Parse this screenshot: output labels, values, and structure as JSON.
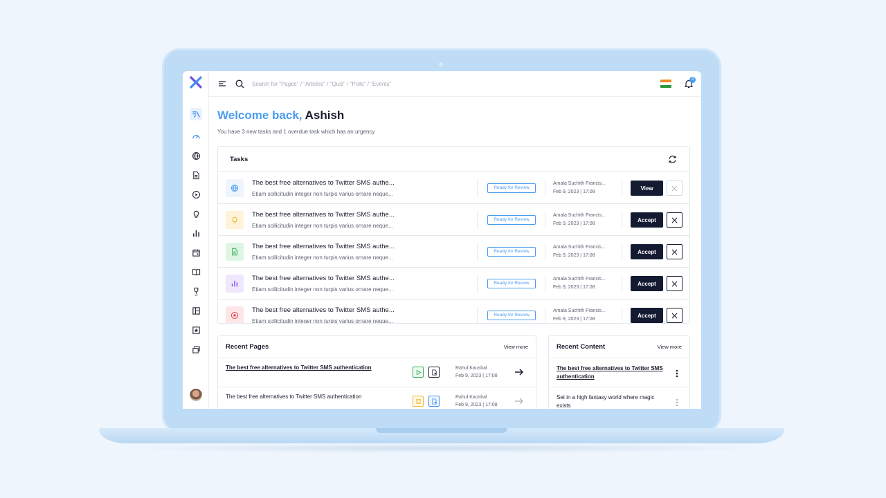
{
  "topbar": {
    "search_placeholder": "Search for \"Pages\" / \"Articles\" / \"Quiz\" / \"Polls\" / \"Events\"",
    "notification_count": "4"
  },
  "welcome": {
    "greeting": "Welcome back,",
    "name": "Ashish",
    "subtitle": "You have 3 new tasks and 1 overdue task which has an urgency"
  },
  "tasks": {
    "title": "Tasks",
    "rows": [
      {
        "icon": "globe-icon",
        "title": "The best free alternatives to Twitter SMS authe...",
        "desc": "Etiam sollicitudin integer non turpis varius ornare neque...",
        "status": "Ready for Review",
        "author": "Amala Suchith Francis...",
        "date": "Feb 9, 2023 | 17:08",
        "action": "View"
      },
      {
        "icon": "bulb-icon",
        "title": "The best free alternatives to Twitter SMS authe...",
        "desc": "Etiam sollicitudin integer non turpis varius ornare neque...",
        "status": "Ready for Review",
        "author": "Amala Suchith Francis...",
        "date": "Feb 9, 2023 | 17:08",
        "action": "Accept"
      },
      {
        "icon": "document-icon",
        "title": "The best free alternatives to Twitter SMS authe...",
        "desc": "Etiam sollicitudin integer non turpis varius ornare neque...",
        "status": "Ready for Review",
        "author": "Amala Suchith Francis...",
        "date": "Feb 9, 2023 | 17:08",
        "action": "Accept"
      },
      {
        "icon": "bar-chart-icon",
        "title": "The best free alternatives to Twitter SMS authe...",
        "desc": "Etiam sollicitudin integer non turpis varius ornare neque...",
        "status": "Ready for Review",
        "author": "Amala Suchith Francis...",
        "date": "Feb 9, 2023 | 17:08",
        "action": "Accept"
      },
      {
        "icon": "play-circle-icon",
        "title": "The best free alternatives to Twitter SMS authe...",
        "desc": "Etiam sollicitudin integer non turpis varius ornare neque...",
        "status": "Ready for Review",
        "author": "Amala Suchith Francis...",
        "date": "Feb 9, 2023 | 17:08",
        "action": "Accept"
      }
    ]
  },
  "recent_pages": {
    "title": "Recent Pages",
    "view_more": "View more",
    "rows": [
      {
        "title": "The best free alternatives to Twitter SMS authentication",
        "author": "Rahul Kaushal",
        "date": "Feb 9, 2023 | 17:08"
      },
      {
        "title": "The best free alternatives to Twitter SMS authentication",
        "author": "Rahul Kaushal",
        "date": "Feb 9, 2023 | 17:08"
      }
    ]
  },
  "recent_content": {
    "title": "Recent Content",
    "view_more": "View more",
    "rows": [
      {
        "title": "The best free alternatives to Twitter SMS authentication"
      },
      {
        "title": "Set in a high fantasy world where magic exists"
      }
    ]
  },
  "colors": {
    "accent": "#4a9cf0",
    "primary_button": "#151a33",
    "background": "#eef5fd"
  }
}
